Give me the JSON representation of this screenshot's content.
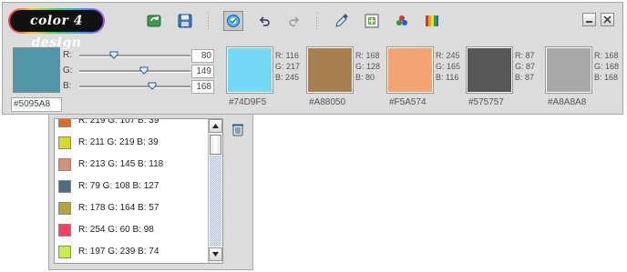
{
  "app": {
    "logo_text": "color 4 design"
  },
  "toolbar": {
    "icons": [
      "refresh-icon",
      "save-icon",
      "color-wheel-icon",
      "undo-icon",
      "redo-icon",
      "eyedropper-icon",
      "add-icon",
      "rgb-dots-icon",
      "palette-icon"
    ]
  },
  "current": {
    "color": "#5095A8",
    "hex": "#5095A8",
    "r_label": "R:",
    "g_label": "G:",
    "b_label": "B:",
    "r": "80",
    "g": "149",
    "b": "168",
    "r_fraction": 0.314,
    "g_fraction": 0.584,
    "b_fraction": 0.659
  },
  "swatches": [
    {
      "color": "#74D9F5",
      "hex": "#74D9F5",
      "r": "R: 116",
      "g": "G: 217",
      "b": "B: 245"
    },
    {
      "color": "#A88050",
      "hex": "#A88050",
      "r": "R: 168",
      "g": "G: 128",
      "b": "B: 80"
    },
    {
      "color": "#F5A574",
      "hex": "#F5A574",
      "r": "R: 245",
      "g": "G: 165",
      "b": "B: 116"
    },
    {
      "color": "#575757",
      "hex": "#575757",
      "r": "R: 87",
      "g": "G: 87",
      "b": "B: 87"
    },
    {
      "color": "#A8A8A8",
      "hex": "#A8A8A8",
      "r": "R: 168",
      "g": "G: 168",
      "b": "B: 168"
    }
  ],
  "history": [
    {
      "color": "#DB6B27",
      "text": "R: 219 G: 107 B: 39"
    },
    {
      "color": "#D3DB27",
      "text": "R: 211 G: 219 B: 39"
    },
    {
      "color": "#D59176",
      "text": "R: 213 G: 145 B: 118"
    },
    {
      "color": "#4F6C7F",
      "text": "R: 79 G: 108 B: 127"
    },
    {
      "color": "#B2A439",
      "text": "R: 178 G: 164 B: 57"
    },
    {
      "color": "#FE3C62",
      "text": "R: 254 G: 60 B: 98"
    },
    {
      "color": "#C5EF4A",
      "text": "R: 197 G: 239 B: 74"
    }
  ]
}
